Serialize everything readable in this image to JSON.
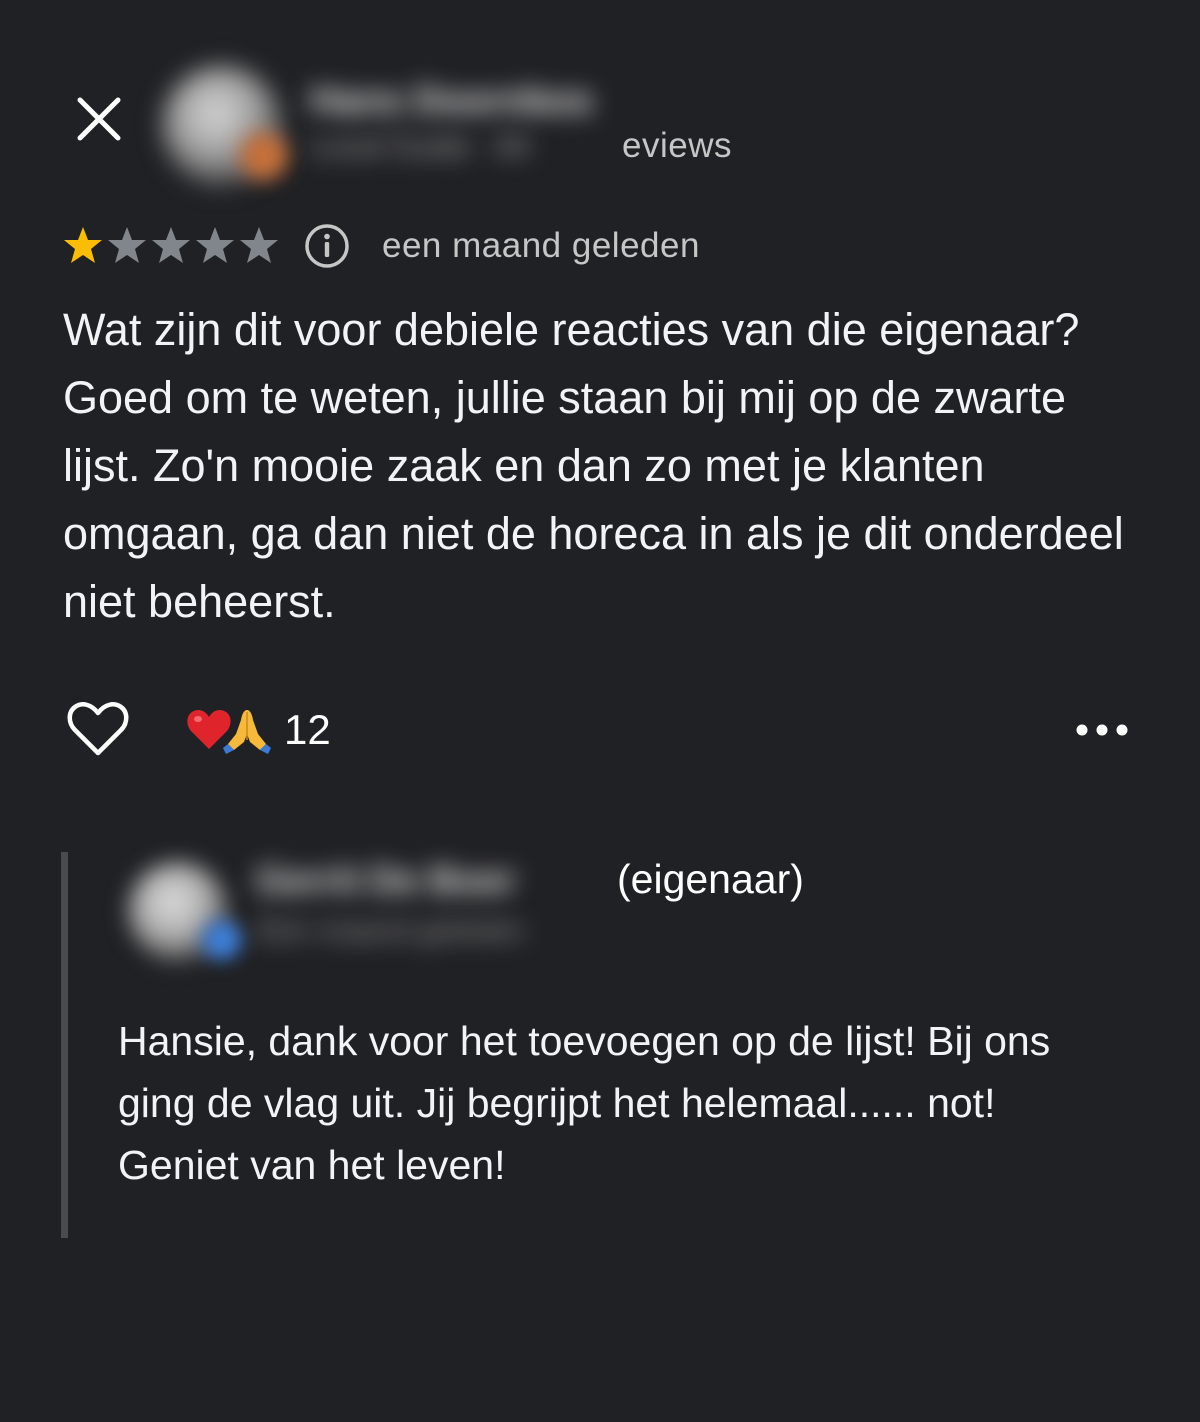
{
  "review": {
    "reviewer_name_blurred": "Hans Doornbos",
    "reviewer_meta_blurred": "Local Guide · 84",
    "reviews_suffix": "eviews",
    "rating": 1,
    "rating_max": 5,
    "time_ago": "een maand geleden",
    "text": "Wat zijn dit voor debiele reacties van die eigenaar? Goed om te weten, jullie staan bij mij op de zwarte lijst. Zo'n mooie zaak en dan zo met je klanten omgaan, ga dan niet de horeca in als je dit onderdeel niet beheerst."
  },
  "actions": {
    "reaction_count": "12"
  },
  "owner_reply": {
    "owner_name_blurred": "Gerrit De Boer",
    "owner_meta_blurred": "Eén maand geleden",
    "owner_label": "(eigenaar)",
    "text": "Hansie, dank voor het toevoegen op de lijst! Bij ons ging de vlag uit. Jij begrijpt het helemaal...... not! Geniet van het leven!"
  },
  "colors": {
    "background": "#202124",
    "star_filled": "#fbbc04",
    "star_empty": "#80868b",
    "reply_bar": "#4a4b4f"
  },
  "icons": [
    "close-icon",
    "star-icon",
    "info-icon",
    "heart-outline-icon",
    "heart-emoji-icon",
    "praying-hands-emoji-icon",
    "more-horizontal-icon"
  ]
}
